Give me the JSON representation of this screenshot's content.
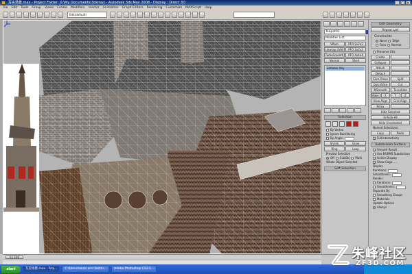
{
  "window": {
    "title": "写实场景.max - Project Folder: D:\\My Documents\\3dsmax - Autodesk 3ds Max 2008 - Display : Direct 3D",
    "controls": [
      "_",
      "□",
      "×"
    ]
  },
  "menu": [
    "File",
    "Edit",
    "Tools",
    "Group",
    "Views",
    "Create",
    "Modifiers",
    "reactor",
    "Animation",
    "Graph Editors",
    "Rendering",
    "Customize",
    "MAXScript",
    "Help"
  ],
  "toolbar": {
    "selection_set": "Edit(default)"
  },
  "viewport": {
    "label": ""
  },
  "command_panel": {
    "object_name": "Teapot01",
    "object_color": "#1e3ad6",
    "modifier_list": "Modifier List",
    "buttons": [
      "VRam",
      "PFO 2x2x2",
      "Unwrap UVW",
      "PFO 2x2x2",
      "TurboSmooth",
      "PFO 4x4x4",
      "Normal",
      "Shell"
    ],
    "stack_item": "Editable Poly",
    "selection_title": "Selection",
    "selection_rows": [
      "By Vertex",
      "Ignore Backfacing",
      "By Angle:",
      "Shrink",
      "Grow",
      "Ring",
      "Loop"
    ],
    "preview_title": "Preview Selection",
    "preview_options": [
      "Off",
      "SubObj",
      "Multi"
    ],
    "whole_object": "Whole Object Selected",
    "soft_selection": "Soft Selection"
  },
  "geometry_panel": {
    "edit_geometry": "Edit Geometry",
    "repeat_last": "Repeat Last",
    "constraints": "Constraints",
    "constraint_options": [
      "None",
      "Edge",
      "Face",
      "Normal"
    ],
    "preserve_uvs": "Preserve UVs",
    "create": "Create",
    "collapse": "Collapse",
    "attach": "Attach",
    "detach": "Detach",
    "slice_plane": "Slice Plane",
    "split": "Split",
    "quickslice": "QuickSlice",
    "cut": "Cut",
    "msmooth": "MSmooth",
    "tessellate": "Tessellate",
    "make_planar": "Make Planar",
    "xyz": [
      "X",
      "Y",
      "Z"
    ],
    "view_align": "View Align",
    "grid_align": "Grid Align",
    "relax": "Relax",
    "hide_selected": "Hide Selected",
    "unhide_all": "Unhide All",
    "hide_unselected": "Hide Unselected",
    "named_selections": "Named Selections:",
    "copy": "Copy",
    "paste": "Paste",
    "full_interactivity": "Full Interactivity",
    "subdivision_surface": "Subdivision Surface",
    "smooth_result": "Smooth Result",
    "use_nurms": "Use NURMS Subdivision",
    "isoline_display": "Isoline Display",
    "show_cage": "Show Cage......",
    "display": "Display",
    "iterations": "Iterations:",
    "smoothness": "Smoothness:",
    "render": "Render",
    "separate_by": "Separate By",
    "smoothing_groups": "Smoothing Groups",
    "materials": "Materials",
    "update_options": "Update Options",
    "always": "Always"
  },
  "timeline": {
    "slider": "0 / 100"
  },
  "taskbar": {
    "start": "start",
    "items": [
      "写实场景.max - Proj...",
      "C:\\Documents and Settin...",
      "Adobe Photoshop CS3 E..."
    ]
  },
  "watermark": {
    "main": "朱峰社区",
    "sub": "ZF3D.COM"
  }
}
